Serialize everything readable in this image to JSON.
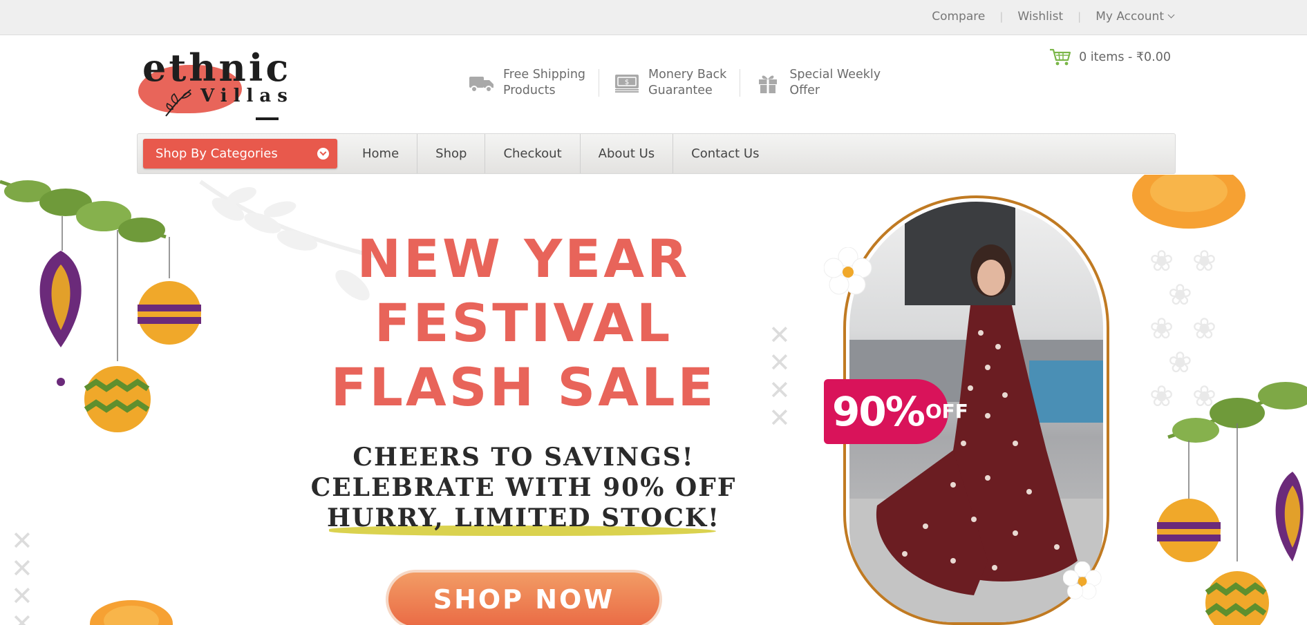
{
  "topbar": {
    "compare": "Compare",
    "wishlist": "Wishlist",
    "account": "My Account"
  },
  "logo": {
    "line1": "ethnic",
    "line2": "Villas"
  },
  "features": [
    {
      "icon": "truck-icon",
      "line1": "Free Shipping",
      "line2": "Products"
    },
    {
      "icon": "money-icon",
      "line1": "Monery Back",
      "line2": "Guarantee"
    },
    {
      "icon": "gift-icon",
      "line1": "Special Weekly",
      "line2": "Offer"
    }
  ],
  "cart": {
    "icon": "cart-icon",
    "summary": "0 items -  ₹0.00"
  },
  "nav": {
    "categories_label": "Shop By Categories",
    "items": [
      "Home",
      "Shop",
      "Checkout",
      "About Us",
      "Contact Us"
    ]
  },
  "banner": {
    "headline": [
      "NEW YEAR",
      "FESTIVAL",
      "FLASH SALE"
    ],
    "sub": [
      "CHEERS TO SAVINGS!",
      "CELEBRATE WITH 90% OFF",
      "HURRY, LIMITED STOCK!"
    ],
    "cta": "SHOP NOW",
    "badge_percent": "90%",
    "badge_off": "OFF"
  },
  "colors": {
    "accent": "#e8594c",
    "headline": "#e8645a",
    "badge": "#d9135a",
    "frame": "#c07a22",
    "cart_icon": "#7ab648"
  }
}
